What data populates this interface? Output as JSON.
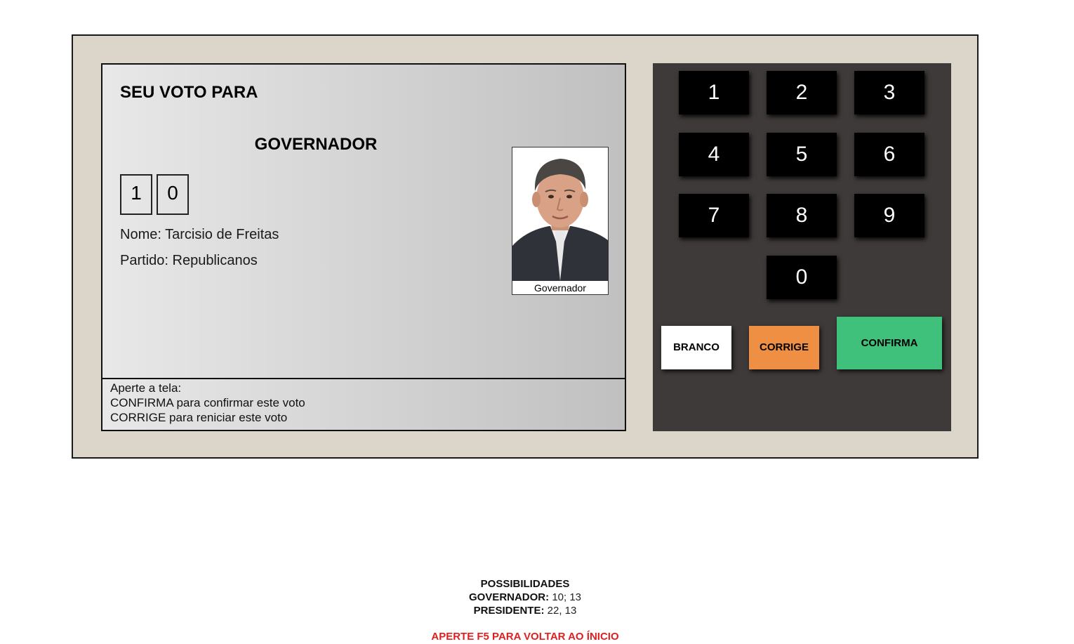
{
  "screen": {
    "seu_voto_para": "SEU VOTO PARA",
    "cargo": "GOVERNADOR",
    "digitos": [
      "1",
      "0"
    ],
    "nome_label": "Nome:",
    "nome_valor": "Tarcisio de Freitas",
    "partido_label": "Partido:",
    "partido_valor": "Republicanos",
    "foto_legenda": "Governador",
    "instrucoes": [
      "Aperte a tela:",
      "CONFIRMA para confirmar este voto",
      "CORRIGE para reniciar este voto"
    ]
  },
  "keypad": {
    "keys": [
      "1",
      "2",
      "3",
      "4",
      "5",
      "6",
      "7",
      "8",
      "9",
      "0"
    ],
    "branco": "BRANCO",
    "corrige": "CORRIGE",
    "confirma": "CONFIRMA"
  },
  "colors": {
    "branco": "#ffffff",
    "corrige": "#ef8f44",
    "confirma": "#3fc07b",
    "aviso": "#e02020"
  },
  "footer": {
    "titulo": "POSSIBILIDADES",
    "governador_label": "GOVERNADOR:",
    "governador_valores": "10; 13",
    "presidente_label": "PRESIDENTE:",
    "presidente_valores": "22, 13",
    "aviso": "APERTE F5 PARA VOLTAR AO ÍNICIO"
  }
}
